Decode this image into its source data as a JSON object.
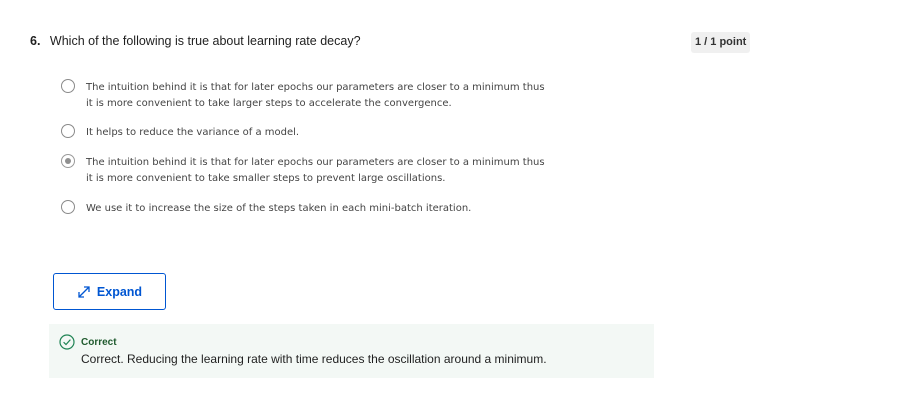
{
  "question": {
    "number": "6.",
    "text": "Which of the following is true about learning rate decay?",
    "points": "1 / 1 point"
  },
  "options": [
    {
      "line1": "The intuition behind it is that for later epochs our parameters are closer to a minimum thus",
      "line2": "it is more convenient to take larger steps to accelerate the convergence.",
      "selected": false
    },
    {
      "line1": "It helps to reduce the variance of a model.",
      "line2": "",
      "selected": false
    },
    {
      "line1": "The intuition behind it is that for later epochs our parameters are closer to a minimum thus",
      "line2": "it is more convenient to take smaller steps to prevent large oscillations.",
      "selected": true
    },
    {
      "line1": "We use it to increase the size of the steps taken in each mini-batch iteration.",
      "line2": "",
      "selected": false
    }
  ],
  "expand": {
    "label": "Expand",
    "icon": "expand-arrows-icon"
  },
  "feedback": {
    "label": "Correct",
    "text": "Correct. Reducing the learning rate with time reduces the oscillation around a minimum.",
    "icon": "check-circle-icon",
    "color": "#1f8354"
  },
  "colors": {
    "accent": "#0056d2",
    "feedback_bg": "#f3f8f5"
  }
}
